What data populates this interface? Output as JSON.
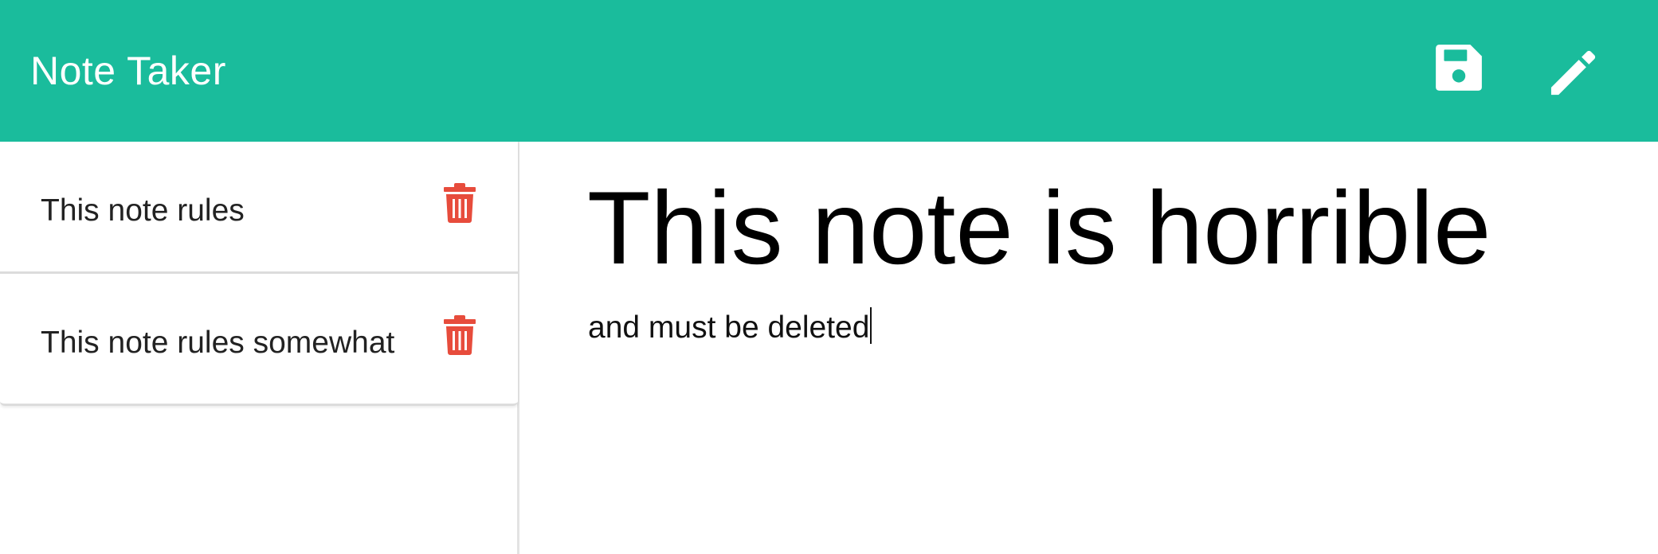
{
  "app": {
    "title": "Note Taker"
  },
  "toolbar": {
    "save_icon": "floppy-disk-icon",
    "write_icon": "pencil-icon",
    "accent_color": "#1abc9c"
  },
  "notes": [
    {
      "title": "This note rules",
      "delete_icon": "trash-icon"
    },
    {
      "title": "This note rules somewhat",
      "delete_icon": "trash-icon"
    }
  ],
  "editor": {
    "title": "This note is horrible",
    "text": "and must be deleted"
  },
  "colors": {
    "delete": "#e74c3c"
  }
}
